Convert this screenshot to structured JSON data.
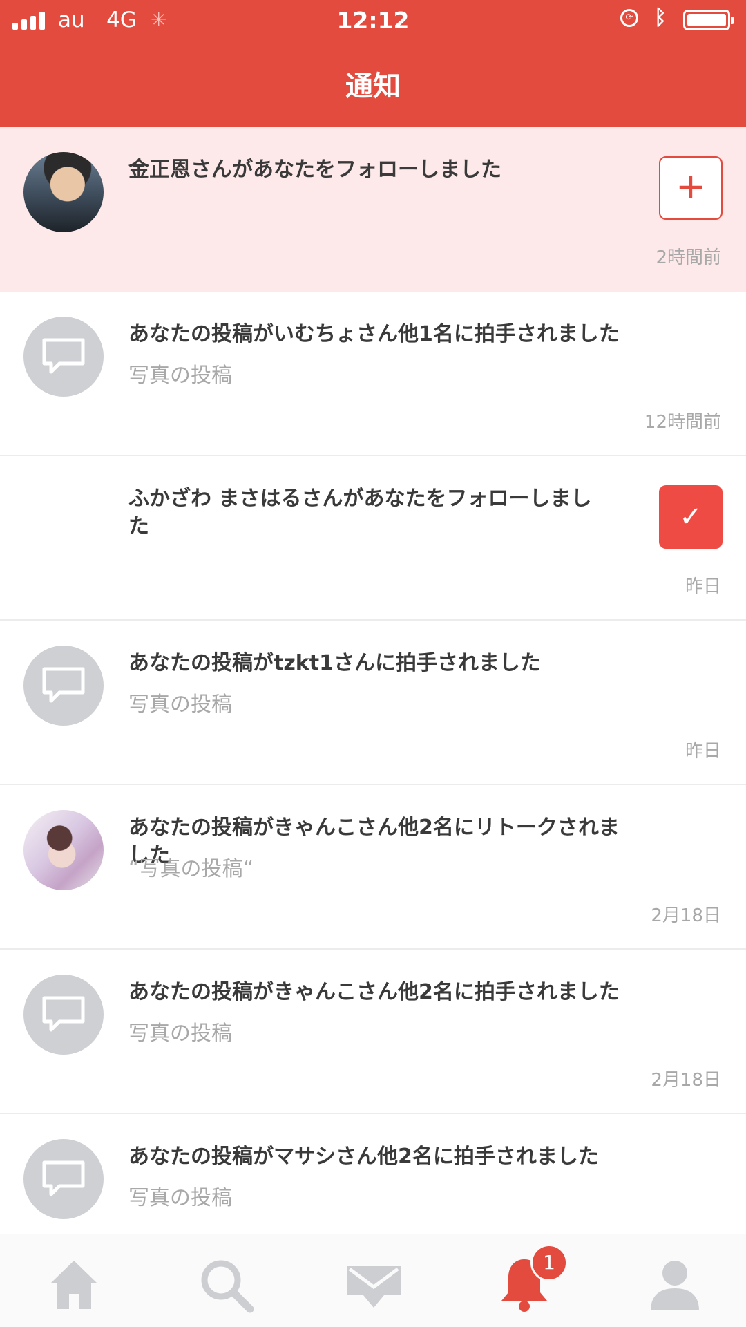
{
  "status_bar": {
    "carrier": "au",
    "network": "4G",
    "time": "12:12"
  },
  "header": {
    "title": "通知"
  },
  "notifications": [
    {
      "message": "金正恩さんがあなたをフォローしました",
      "time": "2時間前"
    },
    {
      "message": "あなたの投稿がいむちょさん他1名に拍手されました",
      "subtitle": "写真の投稿",
      "time": "12時間前"
    },
    {
      "message": "ふかざわ まさはるさんがあなたをフォローしました",
      "time": "昨日"
    },
    {
      "message": "あなたの投稿がtzkt1さんに拍手されました",
      "subtitle": "写真の投稿",
      "time": "昨日"
    },
    {
      "message": "あなたの投稿がきゃんこさん他2名にリトークされました",
      "subtitle": "“写真の投稿“",
      "time": "2月18日"
    },
    {
      "message": "あなたの投稿がきゃんこさん他2名に拍手されました",
      "subtitle": "写真の投稿",
      "time": "2月18日"
    },
    {
      "message": "あなたの投稿がマサシさん他2名に拍手されました",
      "subtitle": "写真の投稿"
    }
  ],
  "buttons": {
    "follow_symbol": "+",
    "following_symbol": "✓"
  },
  "tabbar": {
    "tabs": [
      {
        "icon": "home-icon"
      },
      {
        "icon": "search-icon"
      },
      {
        "icon": "mail-icon"
      },
      {
        "icon": "bell-icon",
        "active": true
      },
      {
        "icon": "user-icon"
      }
    ],
    "badge_count": "1"
  },
  "colors": {
    "accent": "#e34b3f",
    "highlight_bg": "#fde9e9",
    "inactive_icon": "#cdced2"
  }
}
